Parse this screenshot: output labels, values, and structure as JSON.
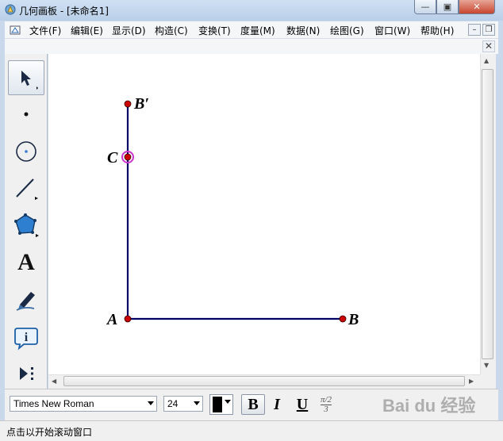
{
  "window": {
    "title": "几何画板 - [未命名1]",
    "buttons": {
      "minimize": "▭",
      "maximize": "▢",
      "close": "✕"
    }
  },
  "menu": {
    "items": [
      {
        "label": "文件(F)"
      },
      {
        "label": "编辑(E)"
      },
      {
        "label": "显示(D)"
      },
      {
        "label": "构造(C)"
      },
      {
        "label": "变换(T)"
      },
      {
        "label": "度量(M)"
      },
      {
        "label": "数据(N)"
      },
      {
        "label": "绘图(G)"
      },
      {
        "label": "窗口(W)"
      },
      {
        "label": "帮助(H)"
      }
    ],
    "mdi_min": "–",
    "mdi_restore": "🗗",
    "doc_close": "✕"
  },
  "toolbox": {
    "tools": [
      {
        "name": "arrow-tool-icon",
        "selected": true
      },
      {
        "name": "point-tool-icon",
        "selected": false
      },
      {
        "name": "compass-tool-icon",
        "selected": false
      },
      {
        "name": "line-tool-icon",
        "selected": false
      },
      {
        "name": "polygon-tool-icon",
        "selected": false
      },
      {
        "name": "text-tool-icon",
        "selected": false,
        "glyph": "A"
      },
      {
        "name": "marker-tool-icon",
        "selected": false
      },
      {
        "name": "information-tool-icon",
        "selected": false
      },
      {
        "name": "custom-tool-icon",
        "selected": false
      }
    ]
  },
  "canvas": {
    "points": [
      {
        "label": "B′",
        "color": "#cc0000"
      },
      {
        "label": "C",
        "color": "#cc0000",
        "highlight": "#cc33cc"
      },
      {
        "label": "A",
        "color": "#cc0000"
      },
      {
        "label": "B",
        "color": "#cc0000"
      }
    ],
    "segment_color": "#000066"
  },
  "textbar": {
    "font_name": "Times New Roman",
    "font_size": "24",
    "bold_label": "B",
    "italic_label": "I",
    "underline_label": "U",
    "symbol_label": "π/2",
    "symbol_denominator": "3",
    "text_color": "#000000"
  },
  "status": {
    "text": "点击以开始滚动窗口"
  },
  "watermark": {
    "text": "Bai du 经验"
  }
}
